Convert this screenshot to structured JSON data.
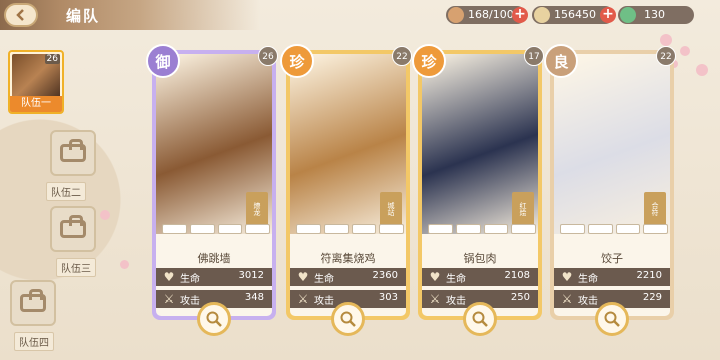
{
  "header": {
    "title": "编队"
  },
  "resources": [
    {
      "name": "stamina",
      "icon": "bun-icon",
      "value": "168/100",
      "color": "#d7a170"
    },
    {
      "name": "currency",
      "icon": "coin-icon",
      "value": "156450",
      "color": "#e8d2a0"
    },
    {
      "name": "jade",
      "icon": "jade-icon",
      "value": "130",
      "color": "#6fbf86"
    }
  ],
  "teams": {
    "active": {
      "label": "队伍一",
      "level": "26"
    },
    "others": [
      {
        "label": "队伍二"
      },
      {
        "label": "队伍三"
      },
      {
        "label": "队伍四"
      }
    ]
  },
  "labels": {
    "hp": "生命",
    "atk": "攻击"
  },
  "cards": [
    {
      "rarity": "御",
      "rarity_color": "#9b7fd2",
      "level": "26",
      "name": "佛跳墙",
      "skill": "燎龙",
      "hp": "3012",
      "atk": "348",
      "frame": "#c7b0ef",
      "art_color": "#8a5a34"
    },
    {
      "rarity": "珍",
      "rarity_color": "#ee9a3a",
      "level": "22",
      "name": "符离集烧鸡",
      "skill": "城站",
      "hp": "2360",
      "atk": "303",
      "frame": "#f3c867",
      "art_color": "#b98347"
    },
    {
      "rarity": "珍",
      "rarity_color": "#ee9a3a",
      "level": "17",
      "name": "锅包肉",
      "skill": "红烩",
      "hp": "2108",
      "atk": "250",
      "frame": "#f3c867",
      "art_color": "#2b3350"
    },
    {
      "rarity": "良",
      "rarity_color": "#c9a07a",
      "level": "22",
      "name": "饺子",
      "skill": "合符",
      "hp": "2210",
      "atk": "229",
      "frame": "#e9cfa9",
      "art_color": "#dcdde6"
    }
  ]
}
